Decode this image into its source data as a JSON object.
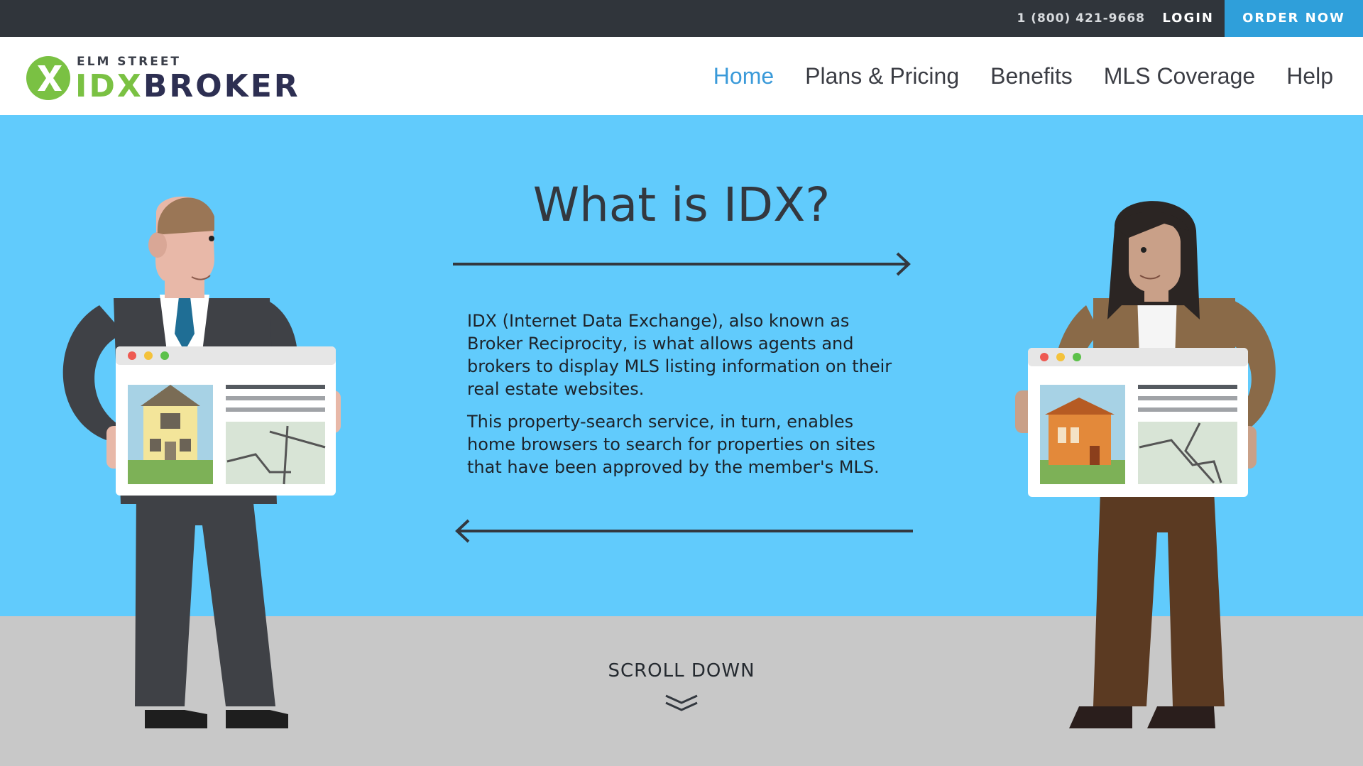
{
  "topbar": {
    "phone": "1 (800) 421-9668",
    "login": "LOGIN",
    "order": "ORDER NOW"
  },
  "logo": {
    "top": "ELM STREET",
    "idx": "IDX",
    "broker": "BROKER"
  },
  "nav": [
    {
      "label": "Home",
      "active": true
    },
    {
      "label": "Plans & Pricing",
      "active": false
    },
    {
      "label": "Benefits",
      "active": false
    },
    {
      "label": "MLS Coverage",
      "active": false
    },
    {
      "label": "Help",
      "active": false
    }
  ],
  "hero": {
    "title": "What is IDX?",
    "paragraphs": [
      "IDX (Internet Data Exchange), also known as Broker Reciprocity, is what allows agents and brokers to display MLS listing information on their real estate websites.",
      "This property-search service, in turn, enables home browsers to search for properties on sites that have been approved by the member's MLS."
    ]
  },
  "scroll": {
    "label": "SCROLL DOWN"
  },
  "icons": {
    "logo": "x-logo-icon",
    "arrow_right": "arrow-right-icon",
    "arrow_left": "arrow-left-icon",
    "scroll": "double-chevron-down-icon"
  },
  "colors": {
    "topbar": "#30353b",
    "order_button": "#2f9fda",
    "nav_active": "#3a9ad9",
    "hero_background": "#61cbfc",
    "floor": "#c8c8c8",
    "logo_green": "#7ac143",
    "logo_navy": "#2d2f52"
  }
}
